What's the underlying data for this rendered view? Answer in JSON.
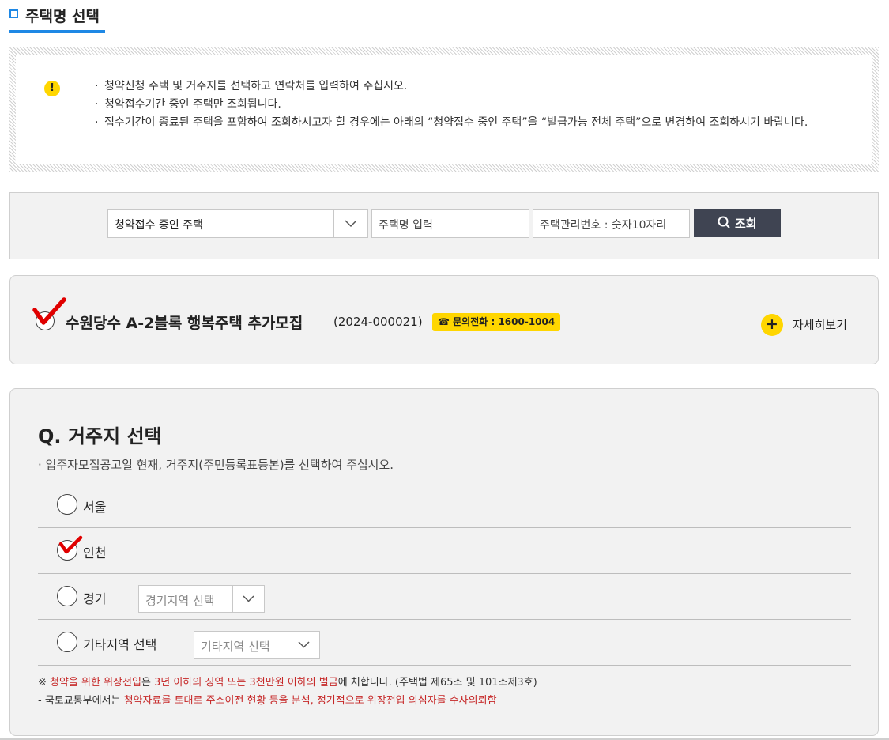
{
  "section": {
    "title": "주택명 선택"
  },
  "notice": {
    "icon": "warning-icon",
    "items": [
      "청약신청 주택 및 거주지를 선택하고 연락처를 입력하여 주십시오.",
      "청약접수기간 중인 주택만 조회됩니다.",
      "접수기간이 종료된 주택을 포함하여 조회하시고자 할 경우에는 아래의 “청약접수 중인 주택”을 “발급가능 전체 주택”으로 변경하여 조회하시기 바랍니다."
    ]
  },
  "search": {
    "type_select": "청약접수 중인 주택",
    "name_placeholder": "주택명 입력",
    "code_placeholder": "주택관리번호 : 숫자10자리",
    "button_label": "조회"
  },
  "house": {
    "name": "수원당수 A-2블록 행복주택 추가모집",
    "code": "(2024-000021)",
    "phone_icon": "☎",
    "phone": "문의전화 : 1600-1004",
    "detail_label": "자세히보기",
    "checked": true
  },
  "residence": {
    "title": "Q. 거주지 선택",
    "description": "· 입주자모집공고일 현재, 거주지(주민등록표등본)를 선택하여 주십시오.",
    "options": [
      {
        "label": "서울",
        "checked": false
      },
      {
        "label": "인천",
        "checked": true
      },
      {
        "label": "경기",
        "select": "경기지역 선택",
        "checked": false
      },
      {
        "label": "기타지역 선택",
        "select": "기타지역 선택",
        "checked": false
      }
    ],
    "warning1": {
      "prefix": "※ ",
      "red": "청약을 위한 위장전입",
      "mid": "은 ",
      "red2": "3년 이하의 징역 또는 3천만원 이하의 벌금",
      "suffix": "에 처합니다. (주택법 제65조 및 101조제3호)"
    },
    "warning2": {
      "prefix": "- 국토교통부에서는 ",
      "red": "청약자료를 토대로 주소이전 현황 등을 분석, 정기적으로 위장전입 의심자를 수사의뢰함"
    }
  },
  "colors": {
    "accent": "#1e88e5",
    "yellow": "#ffd600",
    "button": "#3f4452",
    "red": "#c62828",
    "check": "#e00000"
  }
}
